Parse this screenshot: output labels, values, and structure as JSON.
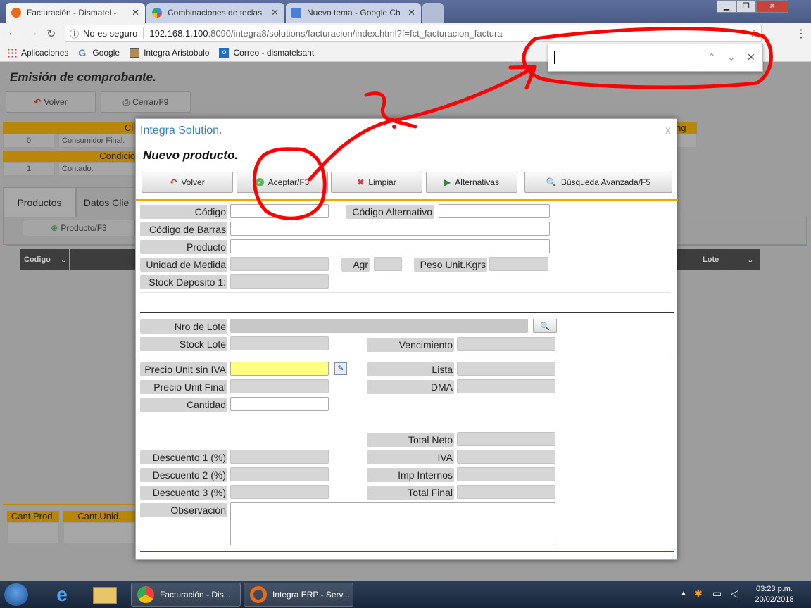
{
  "browser": {
    "tabs": [
      {
        "title": "Facturación - Dismatel -",
        "active": true
      },
      {
        "title": "Combinaciones de teclas",
        "active": false
      },
      {
        "title": "Nuevo tema - Google Ch",
        "active": false
      }
    ],
    "security_label": "No es seguro",
    "url_host": "192.168.1.100",
    "url_rest": ":8090/integra8/solutions/facturacion/index.html?f=fct_facturacion_factura",
    "bookmarks": [
      "Aplicaciones",
      "Google",
      "Integra Aristobulo",
      "Correo - dismatelsant"
    ],
    "find_query": ""
  },
  "page": {
    "title": "Emisión de comprobante.",
    "volver": "Volver",
    "cerrar": "Cerrar/F9",
    "cliente_header": "Cli",
    "cliente_code": "0",
    "cliente_name": "Consumidor Final.",
    "condicion_header": "Condicio",
    "condicion_code": "1",
    "condicion_name": "Contado.",
    "right_header_fragment": "ng",
    "tabs": [
      "Productos",
      "Datos Clie"
    ],
    "producto_btn": "Producto/F3",
    "columns": {
      "codigo": "Codigo",
      "lote": "Lote"
    },
    "footer_cols": [
      "Cant.Prod.",
      "Cant.Unid."
    ]
  },
  "modal": {
    "app_title": "Integra Solution.",
    "close": "x",
    "heading": "Nuevo producto.",
    "buttons": {
      "volver": "Volver",
      "aceptar": "Aceptar/F3",
      "limpiar": "Limpiar",
      "alternativas": "Alternativas",
      "busqueda": "Búsqueda Avanzada/F5"
    },
    "labels": {
      "codigo": "Código",
      "codigo_alt": "Código Alternativo",
      "codigo_barras": "Código de Barras",
      "producto": "Producto",
      "unidad": "Unidad de Medida",
      "agr": "Agr",
      "peso": "Peso Unit.Kgrs",
      "stock_deposito": "Stock Deposito 1:",
      "nro_lote": "Nro de Lote",
      "stock_lote": "Stock Lote",
      "vencimiento": "Vencimiento",
      "precio_sin_iva": "Precio Unit sin IVA",
      "lista": "Lista",
      "precio_final": "Precio Unit Final",
      "dma": "DMA",
      "cantidad": "Cantidad",
      "total_neto": "Total Neto",
      "desc1": "Descuento 1 (%)",
      "iva": "IVA",
      "desc2": "Descuento 2 (%)",
      "imp_internos": "Imp Internos",
      "desc3": "Descuento 3 (%)",
      "total_final": "Total Final",
      "observacion": "Observación"
    }
  },
  "taskbar": {
    "tasks": [
      "Facturación - Dis...",
      "Integra ERP - Serv..."
    ],
    "time": "03:23 p.m.",
    "date": "20/02/2018"
  },
  "colors": {
    "accent_orange": "#f0a500",
    "annotation_red": "#ff0000",
    "precio_highlight": "#ffff80"
  }
}
